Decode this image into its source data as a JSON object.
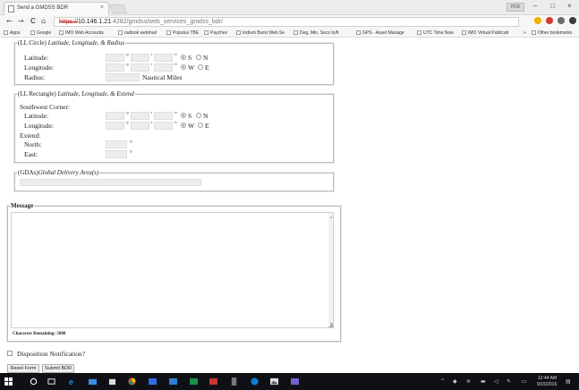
{
  "browser": {
    "tab_title": "Send a GMDSS BDR",
    "tab_close": "×",
    "user_badge": "PDD",
    "win_min": "–",
    "win_max": "□",
    "win_close": "×",
    "back": "←",
    "forward": "→",
    "reload": "C",
    "home": "⌂",
    "url_scheme": "https://",
    "url_host": "10.146.1.21",
    "url_path": ":4282/gmdss/web_services_gmdss_bdr/",
    "bookmarks": [
      "Apps",
      "Google",
      "IMO Web Accounts",
      "outlook webmail",
      "Populus TBE",
      "Paychex",
      "Iridium Burst Web Se",
      "Deg, Min, Secs to/fr",
      "GPS - Asset Manage",
      "UTC Time Now",
      "IMO Virtual Publicati"
    ],
    "bookmark_overflow": "»",
    "other_bookmarks": "Other bookmarks",
    "ext_colors": [
      "#f0b400",
      "#d23c30",
      "#6a6a6a",
      "#3a3a3a"
    ]
  },
  "circle": {
    "legend_prefix": "(LL Circle)",
    "legend_italic": "Latitude, Longitude, & Radius",
    "latitude_label": "Latitude:",
    "longitude_label": "Longitude:",
    "radius_label": "Radius:",
    "radius_unit": "Nautical Miles",
    "deg": "°",
    "min": "'",
    "sec": "\"",
    "lat_options": [
      "S",
      "N"
    ],
    "lon_options": [
      "W",
      "E"
    ],
    "lat_selected": "S",
    "lon_selected": "W"
  },
  "rectangle": {
    "legend_prefix": "(LL Rectangle)",
    "legend_italic": "Latitude, Longitude, & Extend",
    "sw_corner_label": "Southwest Corner:",
    "latitude_label": "Latitude:",
    "longitude_label": "Longitude:",
    "extend_label": "Extend:",
    "north_label": "North:",
    "east_label": "East:",
    "deg": "°",
    "min": "'",
    "sec": "\"",
    "lat_options": [
      "S",
      "N"
    ],
    "lon_options": [
      "W",
      "E"
    ],
    "lat_selected": "S",
    "lon_selected": "W"
  },
  "gdas": {
    "legend_prefix": "(GDAs)",
    "legend_italic": "Global Delivery Area(s)"
  },
  "message": {
    "legend": "Message",
    "value": "",
    "chars_remaining_label": "Character Remaining:",
    "chars_remaining_value": "5000"
  },
  "disposition": {
    "label": "Disposition Notification?",
    "checked": false
  },
  "buttons": {
    "reset": "Reset Form",
    "submit": "Submit BDR"
  },
  "taskbar": {
    "time": "12:44 AM",
    "date": "9/15/2016",
    "icon_colors": [
      "#ffffff",
      "#ffffff",
      "#ffffff",
      "#1f8fe6",
      "#3c8ee0",
      "#2f7fd0",
      "#e8572a",
      "#2f6fe0",
      "#1d8f4a",
      "#c23a2d",
      "#777777",
      "#0f7fd8",
      "#dddddd",
      "#7a5fd1"
    ]
  }
}
